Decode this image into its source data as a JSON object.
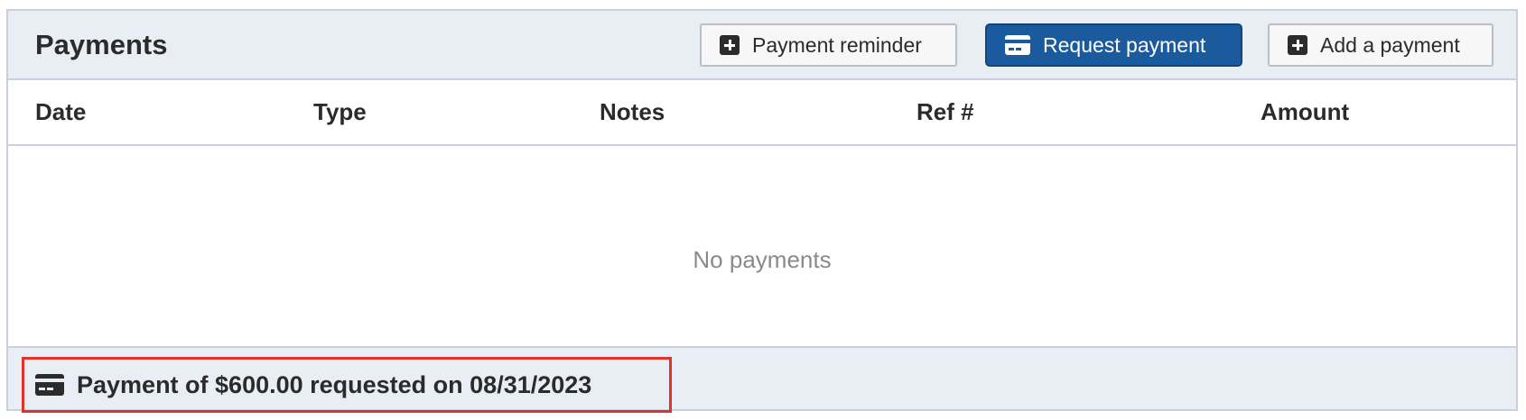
{
  "panel": {
    "title": "Payments"
  },
  "toolbar": {
    "reminder_label": "Payment reminder",
    "request_label": "Request payment",
    "add_label": "Add a payment"
  },
  "table": {
    "columns": [
      "Date",
      "Type",
      "Notes",
      "Ref #",
      "Amount"
    ],
    "empty_message": "No payments"
  },
  "footer": {
    "request_note": "Payment of $600.00 requested on 08/31/2023"
  },
  "icons": {
    "reminder": "plus-square-icon",
    "request": "credit-card-icon",
    "add": "plus-square-icon",
    "note": "credit-card-icon"
  },
  "colors": {
    "primary": "#1b5a9c",
    "highlight": "#e0342a",
    "panel_bg": "#e9edf4"
  }
}
